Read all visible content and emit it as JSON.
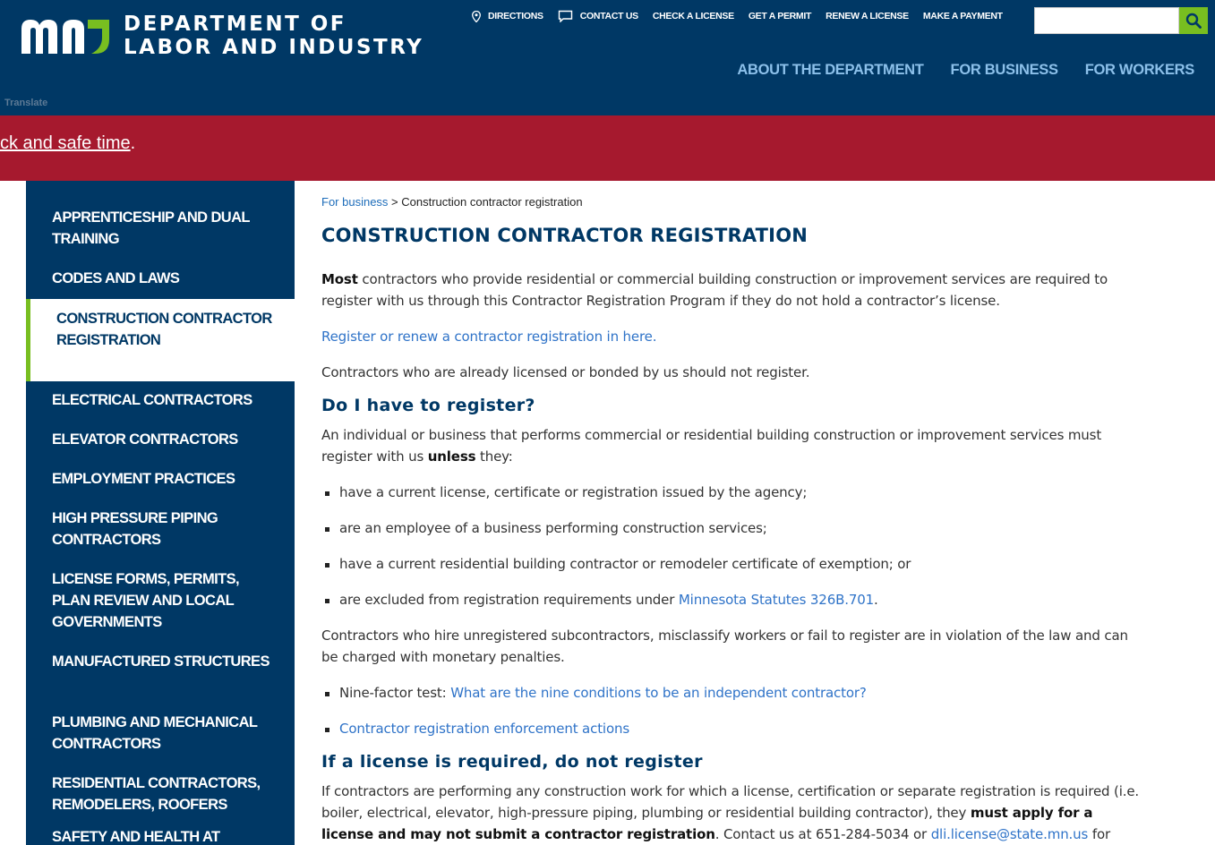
{
  "header": {
    "logo_line1": "DEPARTMENT OF",
    "logo_line2": "LABOR AND INDUSTRY",
    "utility_nav": {
      "directions": "DIRECTIONS",
      "contact": "CONTACT US",
      "check_license": "CHECK A LICENSE",
      "get_permit": "GET A PERMIT",
      "renew_license": "RENEW A LICENSE",
      "make_payment": "MAKE A PAYMENT"
    },
    "search_placeholder": "",
    "main_nav": {
      "about": "ABOUT THE DEPARTMENT",
      "business": "FOR BUSINESS",
      "workers": "FOR WORKERS"
    },
    "translate": "Translate"
  },
  "alert": {
    "link_text": "ck and safe time",
    "suffix": "."
  },
  "sidebar": {
    "items": [
      "APPRENTICESHIP AND DUAL TRAINING",
      "CODES AND LAWS",
      "CONSTRUCTION CONTRACTOR REGISTRATION",
      "ELECTRICAL CONTRACTORS",
      "ELEVATOR CONTRACTORS",
      "EMPLOYMENT PRACTICES",
      "HIGH PRESSURE PIPING CONTRACTORS",
      "LICENSE FORMS, PERMITS, PLAN REVIEW AND LOCAL GOVERNMENTS",
      "MANUFACTURED STRUCTURES",
      "PLUMBING AND MECHANICAL CONTRACTORS",
      "RESIDENTIAL CONTRACTORS, REMODELERS, ROOFERS",
      "SAFETY AND HEALTH AT"
    ]
  },
  "content": {
    "breadcrumb_link": "For business",
    "breadcrumb_sep": " > ",
    "breadcrumb_current": "Construction contractor registration",
    "title": "CONSTRUCTION CONTRACTOR REGISTRATION",
    "intro_bold": "Most",
    "intro_rest": " contractors who provide residential or commercial building construction or improvement services are required to register with us through this Contractor Registration Program if they do not hold a contractor’s license.",
    "register_link": "Register or renew a contractor registration in here.",
    "licensed_note": "Contractors who are already licensed or bonded by us should not register.",
    "h2_register": "Do I have to register?",
    "register_intro_a": "An individual or business that performs commercial or residential building construction or improvement services must register with us ",
    "register_intro_bold": "unless",
    "register_intro_b": " they:",
    "bullets": {
      "b1": "have a current license, certificate or registration issued by the agency;",
      "b2": "are an employee of a business performing construction services;",
      "b3": "have a current residential building contractor or remodeler certificate of exemption; or",
      "b4_text": "are excluded from registration requirements under ",
      "b4_link": "Minnesota Statutes 326B.701",
      "b4_end": "."
    },
    "violation": "Contractors who hire unregistered subcontractors, misclassify workers or fail to register are in violation of the law and can be charged with monetary penalties.",
    "bullets2": {
      "nine_prefix": "Nine-factor test: ",
      "nine_link": "What are the nine conditions to be an independent contractor?",
      "enforcement_link": "Contractor registration enforcement actions"
    },
    "h2_license": "If a license is required, do not register",
    "license_a": "If contractors are performing any construction work for which a license, certification or separate registration is required (i.e. boiler, electrical, elevator, high-pressure piping, plumbing or residential building contractor), they ",
    "license_bold": "must apply for a license and may not submit a contractor registration",
    "license_b": ". Contact us at 651-284-5034 or ",
    "license_email": "dli.license@state.mn.us",
    "license_c": " for more"
  },
  "colors": {
    "navy": "#003865",
    "green": "#78be20",
    "alert_red": "#a6192e",
    "link_blue": "#2f73c8",
    "nav_light_blue": "#8cc0ea"
  }
}
